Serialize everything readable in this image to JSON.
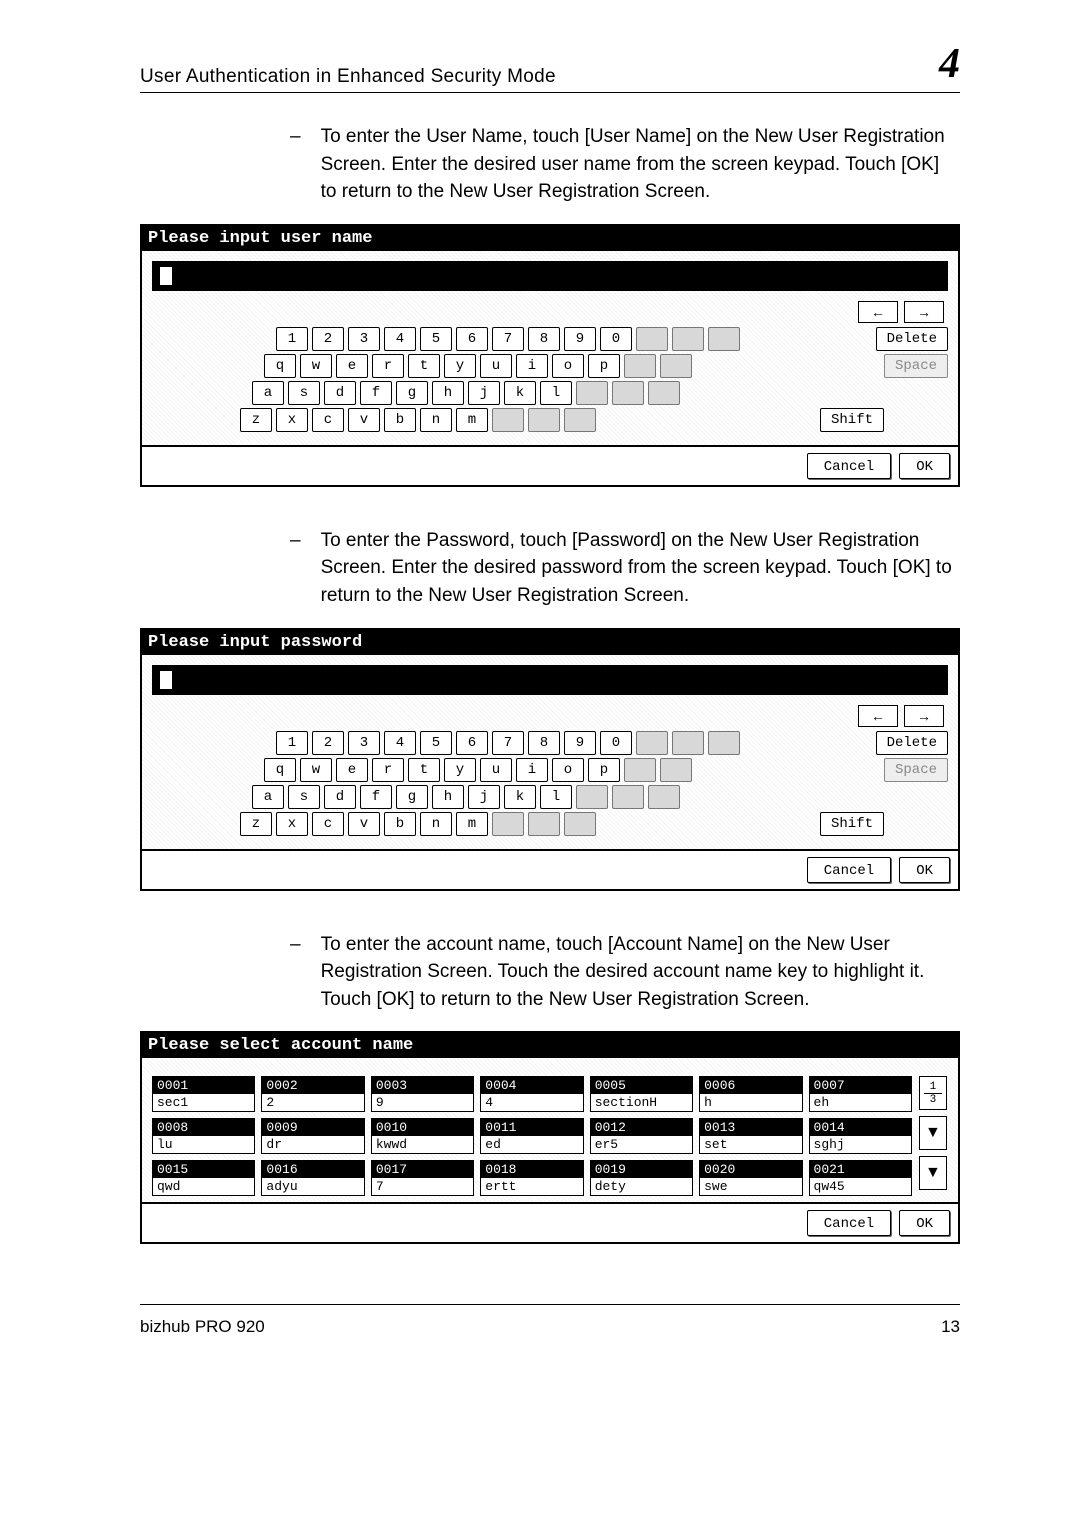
{
  "header": {
    "title": "User Authentication in Enhanced Security Mode",
    "chapter": "4"
  },
  "para1": "To enter the User Name, touch [User Name] on the New User Registration Screen. Enter the desired user name from the screen keypad. Touch [OK] to return to the New User Registration Screen.",
  "para2": "To enter the Password, touch [Password] on the New User Registration Screen. Enter the desired password from the screen keypad. Touch [OK] to return to the New User Registration Screen.",
  "para3": "To enter the account name, touch [Account Name] on the New User Registration Screen. Touch the desired account name key to highlight it. Touch [OK] to return to the New User Registration Screen.",
  "kb1": {
    "title": "Please input user name"
  },
  "kb2": {
    "title": "Please input password"
  },
  "keys": {
    "nums": [
      "1",
      "2",
      "3",
      "4",
      "5",
      "6",
      "7",
      "8",
      "9",
      "0"
    ],
    "row1": [
      "q",
      "w",
      "e",
      "r",
      "t",
      "y",
      "u",
      "i",
      "o",
      "p"
    ],
    "row2": [
      "a",
      "s",
      "d",
      "f",
      "g",
      "h",
      "j",
      "k",
      "l"
    ],
    "row3": [
      "z",
      "x",
      "c",
      "v",
      "b",
      "n",
      "m"
    ],
    "arrow_left": "←",
    "arrow_right": "→",
    "delete": "Delete",
    "space": "Space",
    "shift": "Shift",
    "cancel": "Cancel",
    "ok": "OK"
  },
  "accounts": {
    "title": "Please select account name",
    "page": "1\n3",
    "cols": [
      [
        {
          "id": "0001",
          "v": "sec1"
        },
        {
          "id": "0008",
          "v": "lu"
        },
        {
          "id": "0015",
          "v": "qwd"
        }
      ],
      [
        {
          "id": "0002",
          "v": "2"
        },
        {
          "id": "0009",
          "v": "dr"
        },
        {
          "id": "0016",
          "v": "adyu"
        }
      ],
      [
        {
          "id": "0003",
          "v": "9"
        },
        {
          "id": "0010",
          "v": "kwwd"
        },
        {
          "id": "0017",
          "v": "7"
        }
      ],
      [
        {
          "id": "0004",
          "v": "4"
        },
        {
          "id": "0011",
          "v": "ed"
        },
        {
          "id": "0018",
          "v": "ertt"
        }
      ],
      [
        {
          "id": "0005",
          "v": "sectionH"
        },
        {
          "id": "0012",
          "v": "er5"
        },
        {
          "id": "0019",
          "v": "dety"
        }
      ],
      [
        {
          "id": "0006",
          "v": "h"
        },
        {
          "id": "0013",
          "v": "set"
        },
        {
          "id": "0020",
          "v": "swe"
        }
      ],
      [
        {
          "id": "0007",
          "v": "eh"
        },
        {
          "id": "0014",
          "v": "sghj"
        },
        {
          "id": "0021",
          "v": "qw45"
        }
      ]
    ],
    "cancel": "Cancel",
    "ok": "OK"
  },
  "footer": {
    "product": "bizhub PRO 920",
    "page": "13"
  }
}
